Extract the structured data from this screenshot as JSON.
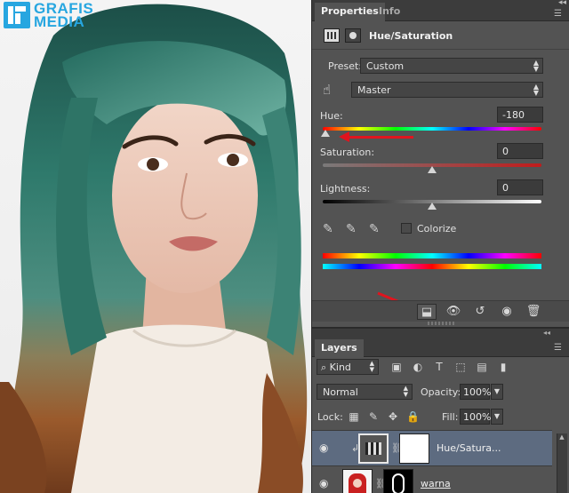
{
  "logo": {
    "line1": "GRAFIS",
    "line2": "MEDIA"
  },
  "properties": {
    "tabs": [
      "Properties",
      "Info"
    ],
    "adjustment_title": "Hue/Saturation",
    "preset_label": "Preset:",
    "preset_value": "Custom",
    "channel_value": "Master",
    "hue_label": "Hue:",
    "hue_value": "-180",
    "saturation_label": "Saturation:",
    "saturation_value": "0",
    "lightness_label": "Lightness:",
    "lightness_value": "0",
    "colorize_label": "Colorize",
    "hue_level": -180,
    "saturation_level": 0,
    "lightness_level": 0
  },
  "layers": {
    "tab": "Layers",
    "kind_label": "Kind",
    "blend_mode": "Normal",
    "opacity_label": "Opacity:",
    "opacity_value": "100%",
    "lock_label": "Lock:",
    "fill_label": "Fill:",
    "fill_value": "100%",
    "items": [
      {
        "name": "Hue/Satura...",
        "selected": true
      },
      {
        "name": "warna",
        "selected": false
      }
    ]
  },
  "icons": {
    "eye": "eye-icon",
    "hand": "targeted-adjustment-icon",
    "clip": "clip-to-layer-icon",
    "reset": "reset-icon",
    "trash": "trash-icon"
  },
  "colors": {
    "panel_bg": "#535353",
    "selected_layer": "#5d6b80",
    "annotation_red": "#e0141e",
    "logo_blue": "#27a6e0"
  }
}
